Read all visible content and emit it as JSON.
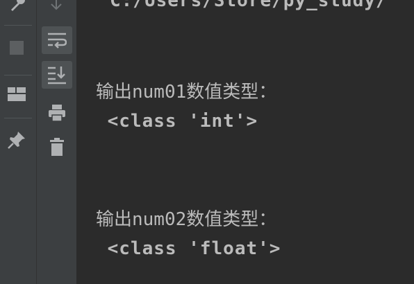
{
  "console": {
    "path_fragment": "C:/Users/Store/py_study/",
    "lines": [
      {
        "label": "输出num01数值类型：",
        "value": " <class 'int'>"
      },
      {
        "label": "输出num02数值类型：",
        "value": " <class 'float'>"
      }
    ]
  },
  "toolbar": {
    "icons": [
      "wrench-icon",
      "stop-icon",
      "layout-icon",
      "pin-icon",
      "scroll-down-icon",
      "soft-wrap-icon",
      "scroll-to-end-icon",
      "print-icon",
      "trash-icon"
    ]
  },
  "colors": {
    "background": "#2b2b2b",
    "sidebar": "#3c3f41",
    "text": "#bbbbbb",
    "icon": "#afb1b3",
    "selected": "#4e5254"
  }
}
